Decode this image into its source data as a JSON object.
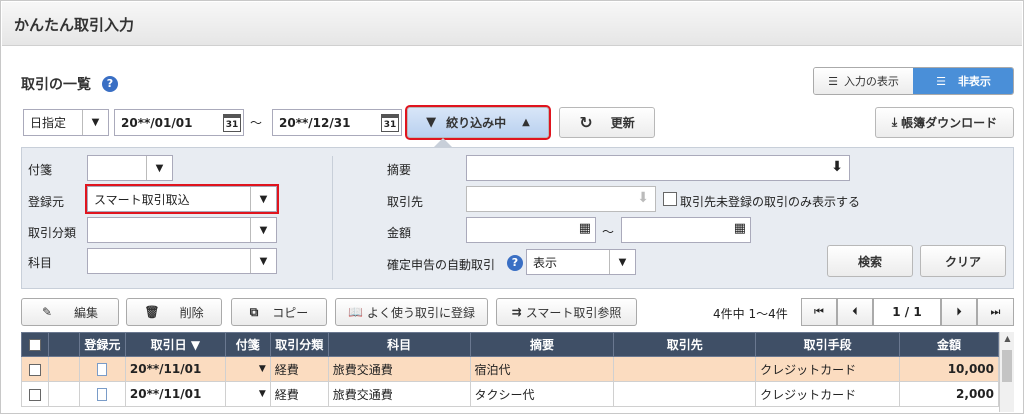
{
  "window": {
    "title": "かんたん取引入力"
  },
  "section": {
    "title": "取引の一覧",
    "help": "?"
  },
  "view_toggle": {
    "show_input": "入力の表示",
    "hide": "非表示"
  },
  "toolbar": {
    "date_mode": "日指定",
    "date_from": "20**/01/01",
    "tilde": "〜",
    "date_to": "20**/12/31",
    "cal_day": "31",
    "filter_label": "絞り込み中",
    "refresh_label": "更新",
    "download_label": "帳簿ダウンロード"
  },
  "filter": {
    "tag_label": "付箋",
    "source_label": "登録元",
    "source_value": "スマート取引取込",
    "category_label": "取引分類",
    "subject_label": "科目",
    "summary_label": "摘要",
    "partner_label": "取引先",
    "partner_unregistered": "取引先未登録の取引のみ表示する",
    "amount_label": "金額",
    "amount_tilde": "〜",
    "auto_label": "確定申告の自動取引",
    "auto_value": "表示",
    "search_button": "検索",
    "clear_button": "クリア"
  },
  "actions": {
    "edit": "編集",
    "delete": "削除",
    "copy": "コピー",
    "register_frequent": "よく使う取引に登録",
    "smart_ref": "スマート取引参照"
  },
  "pager": {
    "count_text": "4件中 1〜4件",
    "page_text": "1 / 1"
  },
  "table": {
    "headers": {
      "source": "登録元",
      "date": "取引日 ▼",
      "tag": "付箋",
      "category": "取引分類",
      "subject": "科目",
      "summary": "摘要",
      "partner": "取引先",
      "method": "取引手段",
      "amount": "金額"
    },
    "rows": [
      {
        "date": "20**/11/01",
        "tag_arrow": "▼",
        "category": "経費",
        "subject": "旅費交通費",
        "summary": "宿泊代",
        "partner": "",
        "method": "クレジットカード",
        "amount": "10,000"
      },
      {
        "date": "20**/11/01",
        "tag_arrow": "▼",
        "category": "経費",
        "subject": "旅費交通費",
        "summary": "タクシー代",
        "partner": "",
        "method": "クレジットカード",
        "amount": "2,000"
      }
    ]
  },
  "colors": {
    "accent": "#3a6fc4",
    "header": "#3f4f66",
    "highlight_row": "#fbdcc0",
    "red_outline": "#e0141e"
  }
}
